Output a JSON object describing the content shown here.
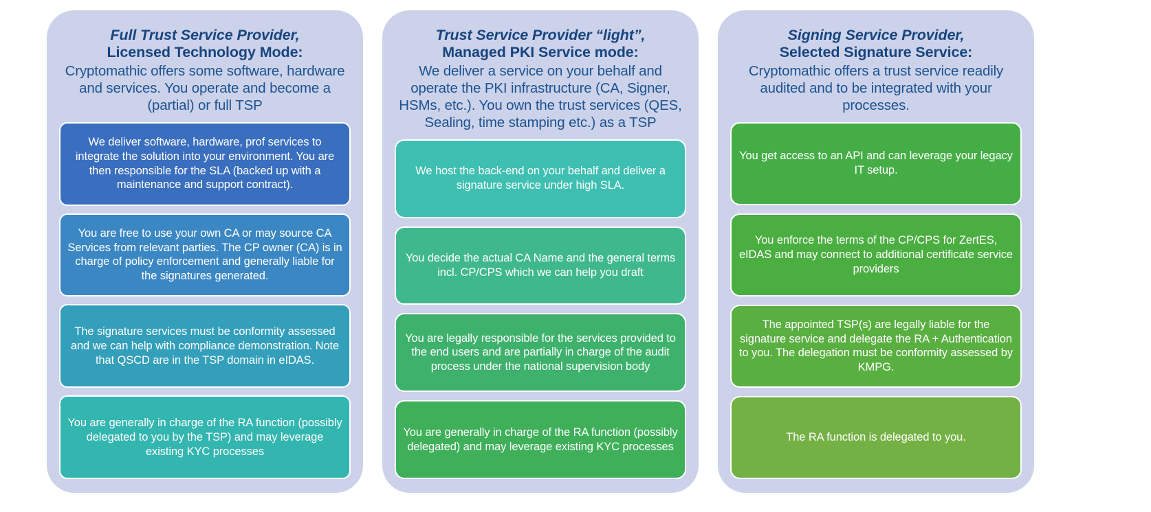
{
  "panel_bg": "#ccd2ea",
  "header_color": "#17457f",
  "columns": [
    {
      "id": "full-trust-service-provider",
      "header": {
        "line1": "Full Trust Service Provider,",
        "line2": "Licensed Technology Mode:",
        "desc": "Cryptomathic offers some software, hardware and services. You operate and become a (partial) or full TSP"
      },
      "cards": [
        {
          "text": "We deliver software, hardware, prof services to integrate the solution into your environment. You are then responsible for the SLA (backed up with a maintenance and support contract).",
          "color": "#3a6ebe"
        },
        {
          "text": "You are free to use your own CA or may source CA Services from relevant parties. The CP owner (CA) is in charge of policy enforcement and generally liable for the signatures generated.",
          "color": "#3b87c4"
        },
        {
          "text": "The signature services must be conformity assessed and we can help with compliance demonstration. Note that QSCD are in the TSP domain in eIDAS.",
          "color": "#339fbb"
        },
        {
          "text": "You are generally in charge of the RA function (possibly delegated to you by the TSP) and may leverage existing KYC processes",
          "color": "#33b5b0"
        }
      ]
    },
    {
      "id": "trust-service-provider-light",
      "header": {
        "line1": "Trust Service Provider “light”,",
        "line2": "Managed PKI Service mode:",
        "desc": "We deliver a service on your behalf and operate the PKI infrastructure (CA, Signer, HSMs, etc.). You own the trust services (QES, Sealing, time stamping etc.) as a TSP"
      },
      "cards": [
        {
          "text": "We host the back-end on your behalf and deliver a signature service under high SLA.",
          "color": "#3ebfb2"
        },
        {
          "text": "You decide the actual CA Name and the general terms incl. CP/CPS which we can help you draft",
          "color": "#40b88e"
        },
        {
          "text": "You are legally responsible for the services provided to the end users and are partially in charge of the audit process under the national supervision body",
          "color": "#3eb16c"
        },
        {
          "text": "You are generally in charge of the RA function (possibly delegated) and may leverage existing KYC processes",
          "color": "#3faf5a"
        }
      ]
    },
    {
      "id": "signing-service-provider",
      "header": {
        "line1": "Signing Service Provider,",
        "line2": "Selected Signature Service:",
        "desc": "Cryptomathic offers a trust service readily audited and to be integrated with your processes."
      },
      "cards": [
        {
          "text": "You get access to an API and can leverage your legacy IT setup.",
          "color": "#45ad46"
        },
        {
          "text": "You enforce the terms of the CP/CPS for ZertES, eIDAS and may connect to additional certificate service providers",
          "color": "#4bae41"
        },
        {
          "text": "The appointed TSP(s) are  legally liable for the signature service and delegate the RA + Authentication to you. The delegation must be conformity assessed by KMPG.",
          "color": "#5aaf41"
        },
        {
          "text": "The RA function is delegated to you.",
          "color": "#74b144"
        }
      ]
    }
  ]
}
